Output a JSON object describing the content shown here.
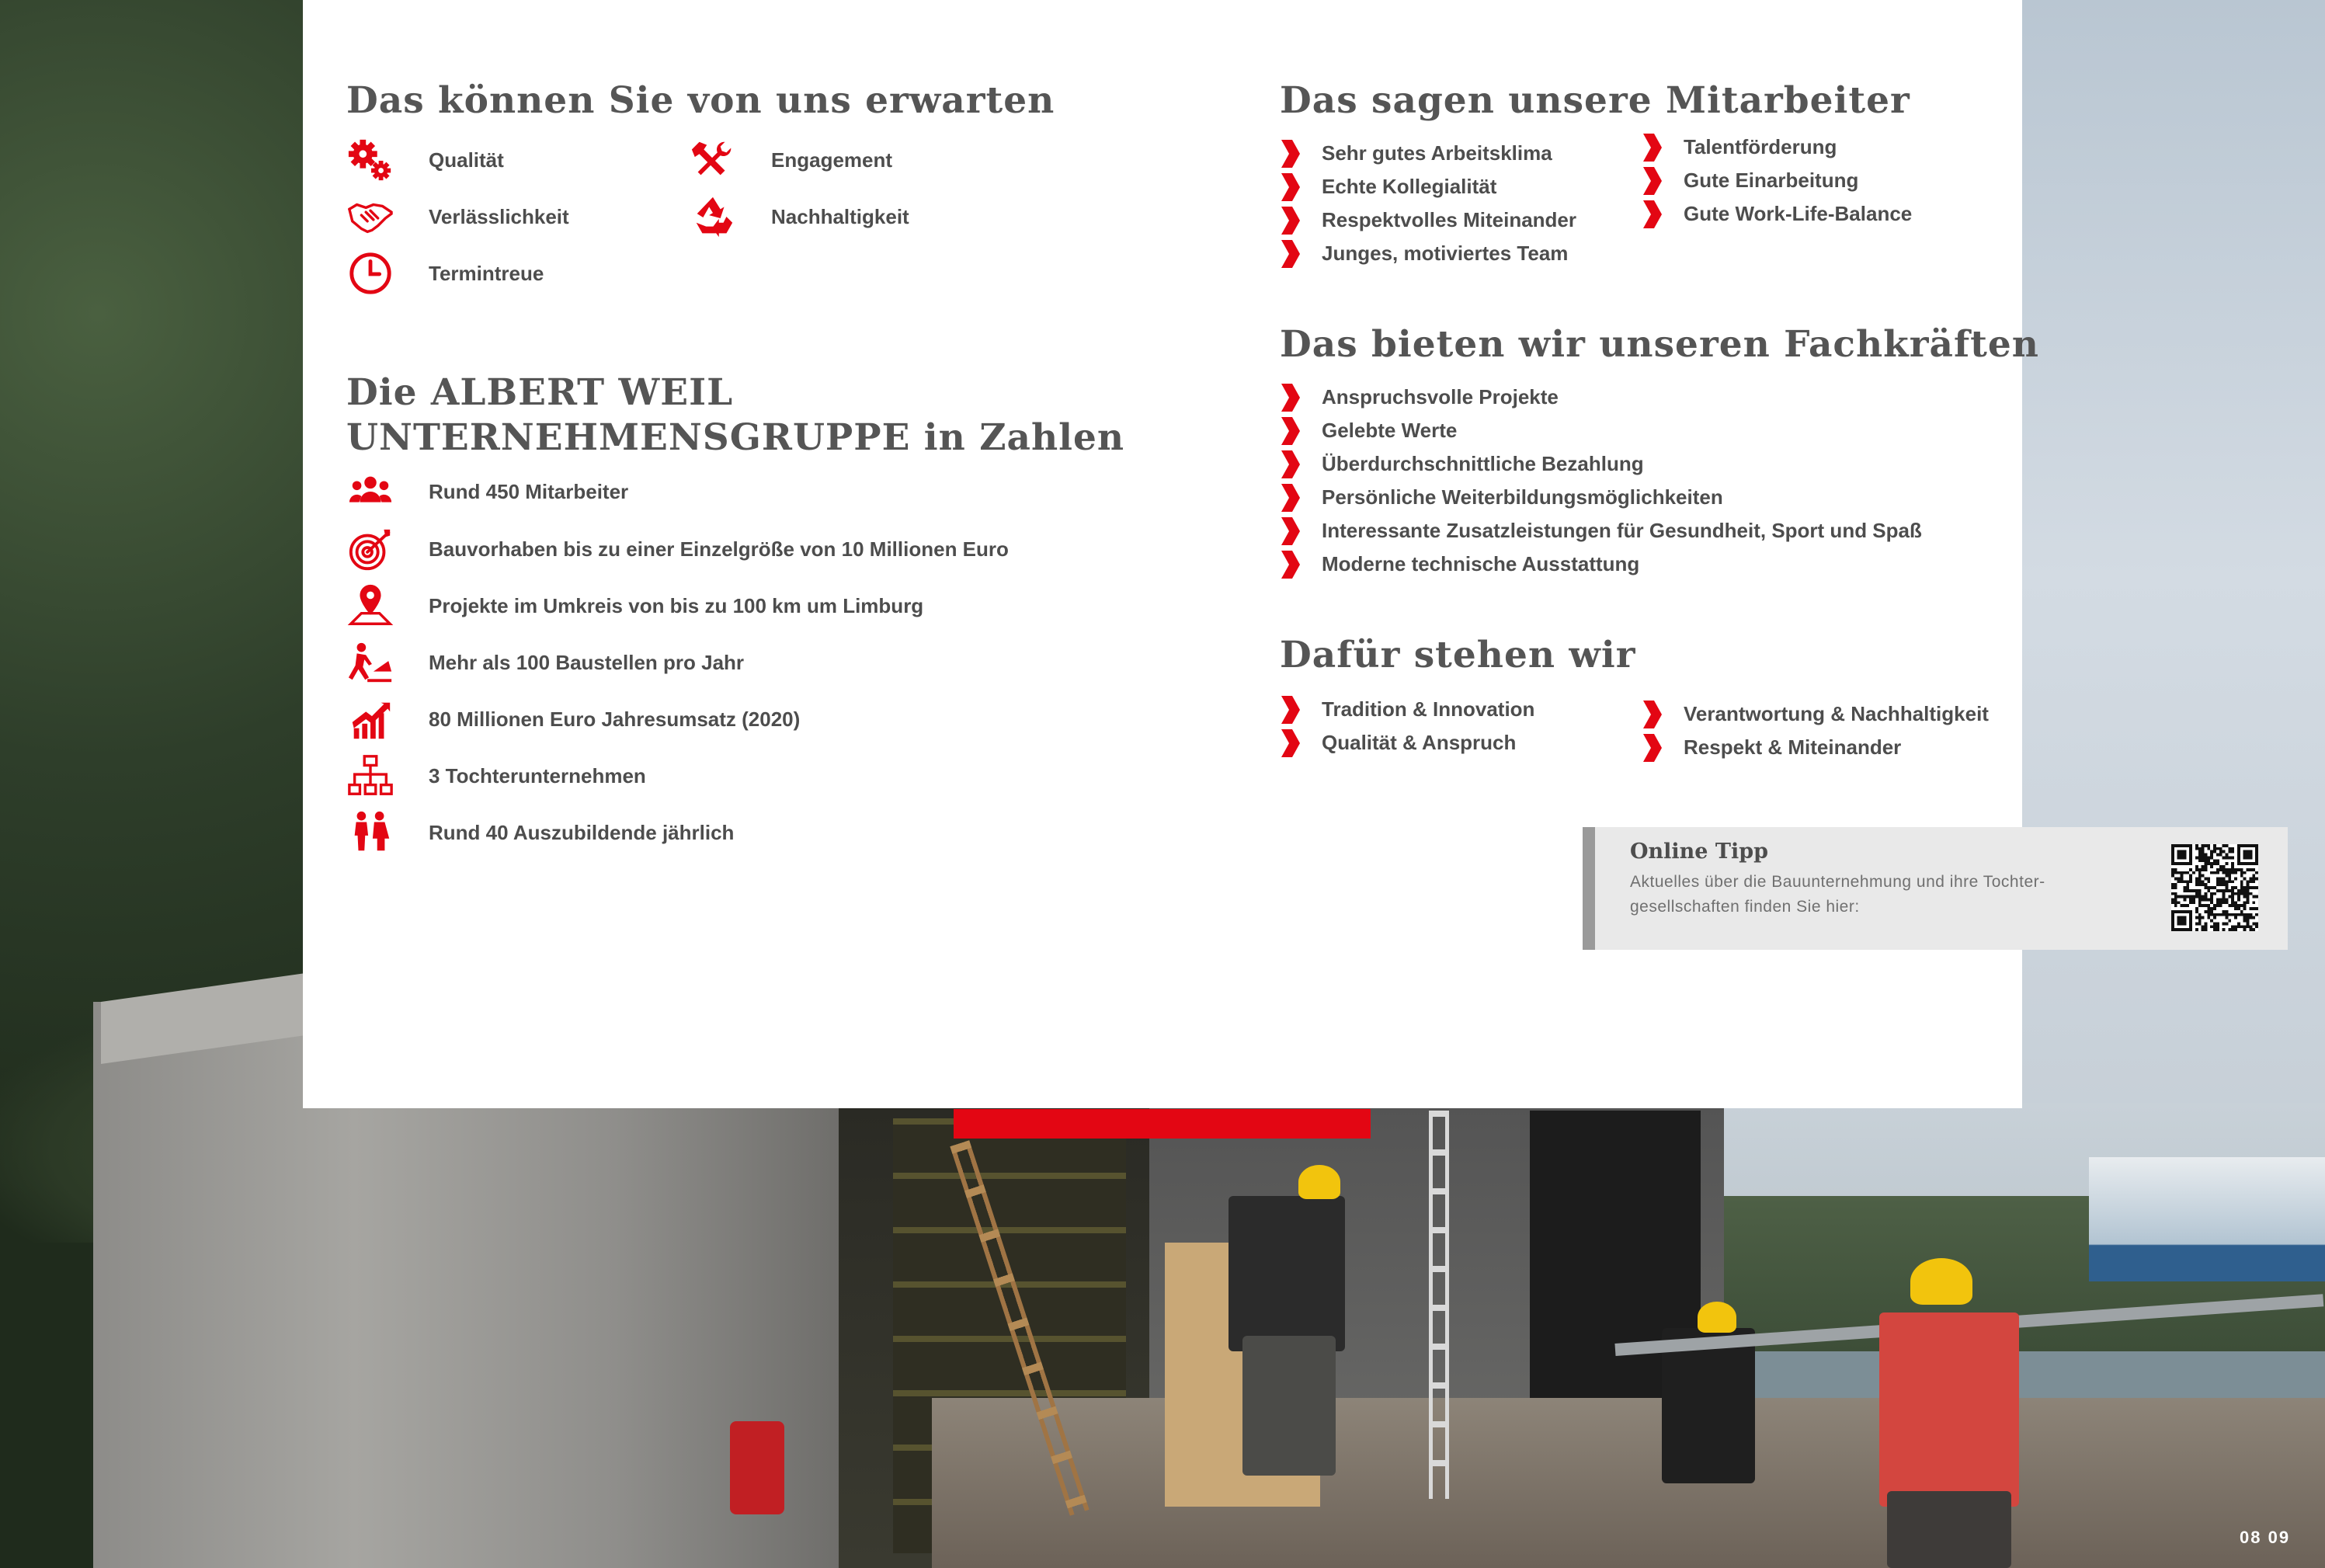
{
  "colors": {
    "accent": "#e30613",
    "heading": "#555555",
    "text": "#4d4d4d",
    "tip_bg": "#e9e9e9"
  },
  "expect": {
    "title": "Das können Sie von uns erwarten",
    "items": [
      {
        "icon": "gears-icon",
        "label": "Qualität"
      },
      {
        "icon": "tools-icon",
        "label": "Engagement"
      },
      {
        "icon": "handshake-icon",
        "label": "Verlässlichkeit"
      },
      {
        "icon": "recycle-icon",
        "label": "Nachhaltigkeit"
      },
      {
        "icon": "clock-icon",
        "label": "Termintreue"
      }
    ]
  },
  "numbers": {
    "title_line1": "Die ALBERT WEIL",
    "title_line2": "UNTERNEHMENSGRUPPE in Zahlen",
    "items": [
      {
        "icon": "people-icon",
        "label": "Rund 450 Mitarbeiter"
      },
      {
        "icon": "target-icon",
        "label": "Bauvorhaben bis zu einer Einzelgröße von 10 Millionen Euro"
      },
      {
        "icon": "map-pin-icon",
        "label": "Projekte im Umkreis von bis zu 100 km um Limburg"
      },
      {
        "icon": "construction-worker-icon",
        "label": "Mehr als 100 Baustellen pro Jahr"
      },
      {
        "icon": "growth-chart-icon",
        "label": "80 Millionen Euro Jahresumsatz (2020)"
      },
      {
        "icon": "org-chart-icon",
        "label": "3 Tochterunternehmen"
      },
      {
        "icon": "trainees-icon",
        "label": "Rund 40 Auszubildende jährlich"
      }
    ]
  },
  "employees": {
    "title": "Das sagen unsere Mitarbeiter",
    "left": [
      "Sehr gutes Arbeitsklima",
      "Echte Kollegialität",
      "Respektvolles Miteinander",
      "Junges, motiviertes Team"
    ],
    "right": [
      "Talentförderung",
      "Gute Einarbeitung",
      "Gute Work-Life-Balance"
    ]
  },
  "offer": {
    "title": "Das bieten wir unseren Fachkräften",
    "items": [
      "Anspruchsvolle Projekte",
      "Gelebte Werte",
      "Überdurchschnittliche Bezahlung",
      "Persönliche Weiterbildungsmöglichkeiten",
      "Interessante Zusatzleistungen für Gesundheit, Sport und Spaß",
      "Moderne technische Ausstattung"
    ]
  },
  "values": {
    "title": "Dafür stehen wir",
    "left": [
      "Tradition & Innovation",
      "Qualität & Anspruch"
    ],
    "right": [
      "Verantwortung & Nachhaltigkeit",
      "Respekt & Miteinander"
    ]
  },
  "tip": {
    "title": "Online Tipp",
    "text": "Aktuelles über die Bauunternehmung und ihre Tochter-gesellschaften finden Sie hier:",
    "qr_icon": "qr-code-icon"
  },
  "page_number": "08 09"
}
